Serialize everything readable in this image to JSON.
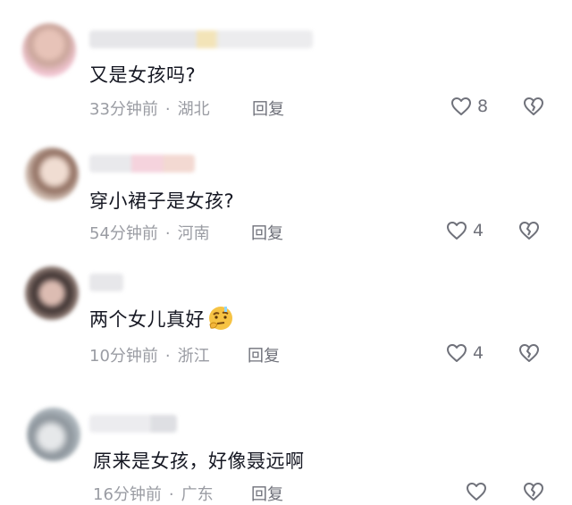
{
  "comments": [
    {
      "text": "又是女孩吗?",
      "time": "33分钟前",
      "location": "湖北",
      "reply_label": "回复",
      "likes": "8",
      "avatar_colors": [
        "#c9a59a",
        "#f2c6d3",
        "#e9a6b8"
      ]
    },
    {
      "text": "穿小裙子是女孩?",
      "time": "54分钟前",
      "location": "河南",
      "reply_label": "回复",
      "likes": "4",
      "avatar_colors": [
        "#9a7d70",
        "#e6d8cf",
        "#c8b2a6"
      ]
    },
    {
      "text": "两个女儿真好",
      "emoji": "thinking-face-emoji",
      "time": "10分钟前",
      "location": "浙江",
      "reply_label": "回复",
      "likes": "4",
      "avatar_colors": [
        "#3a2f2e",
        "#d8b6ad",
        "#a58f86"
      ]
    },
    {
      "text": "原来是女孩，好像聂远啊",
      "time": "16分钟前",
      "location": "广东",
      "reply_label": "回复",
      "likes": "",
      "avatar_colors": [
        "#b9c2c8",
        "#8b939a",
        "#e6e8ea"
      ]
    }
  ],
  "icons": {
    "like": "heart-outline-icon",
    "dislike": "broken-heart-icon"
  },
  "colors": {
    "text": "#161823",
    "meta": "#9a9ca3",
    "icon": "#6f717a"
  }
}
